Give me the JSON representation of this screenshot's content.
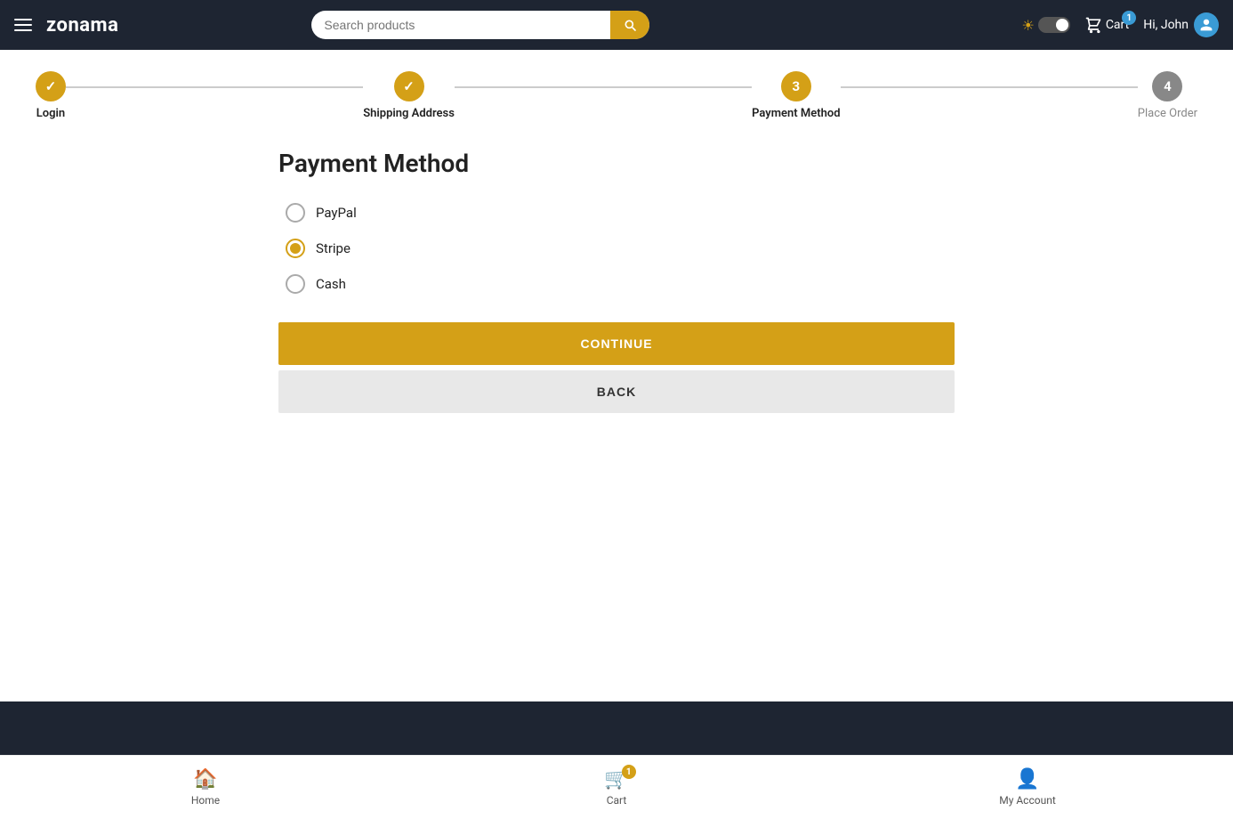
{
  "brand": "zonama",
  "header": {
    "search_placeholder": "Search products",
    "cart_label": "Cart",
    "cart_badge": "1",
    "greeting": "Hi, John",
    "theme_toggle": "toggle"
  },
  "stepper": {
    "steps": [
      {
        "id": 1,
        "label": "Login",
        "state": "done",
        "icon": "✓"
      },
      {
        "id": 2,
        "label": "Shipping Address",
        "state": "done",
        "icon": "✓"
      },
      {
        "id": 3,
        "label": "Payment Method",
        "state": "active",
        "icon": "3"
      },
      {
        "id": 4,
        "label": "Place Order",
        "state": "inactive",
        "icon": "4"
      }
    ]
  },
  "payment": {
    "title": "Payment Method",
    "options": [
      {
        "id": "paypal",
        "label": "PayPal",
        "selected": false
      },
      {
        "id": "stripe",
        "label": "Stripe",
        "selected": true
      },
      {
        "id": "cash",
        "label": "Cash",
        "selected": false
      }
    ],
    "continue_label": "CONTINUE",
    "back_label": "BACK"
  },
  "footer": {
    "nav_items": [
      {
        "id": "home",
        "label": "Home",
        "icon": "🏠"
      },
      {
        "id": "cart",
        "label": "Cart",
        "icon": "🛒",
        "badge": "1"
      },
      {
        "id": "account",
        "label": "My Account",
        "icon": "👤"
      }
    ]
  }
}
